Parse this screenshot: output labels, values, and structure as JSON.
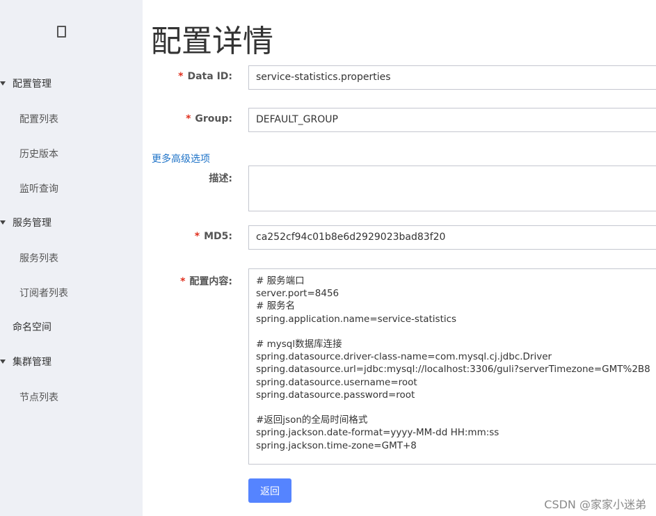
{
  "sidebar": {
    "groups": [
      {
        "label": "配置管理",
        "items": [
          "配置列表",
          "历史版本",
          "监听查询"
        ]
      },
      {
        "label": "服务管理",
        "items": [
          "服务列表",
          "订阅者列表"
        ]
      },
      {
        "label": "命名空间",
        "items": []
      },
      {
        "label": "集群管理",
        "items": [
          "节点列表"
        ]
      }
    ]
  },
  "page": {
    "title": "配置详情"
  },
  "form": {
    "required_mark": "*",
    "data_id": {
      "label": "Data ID:",
      "value": "service-statistics.properties"
    },
    "group": {
      "label": "Group:",
      "value": "DEFAULT_GROUP"
    },
    "advanced_link": "更多高级选项",
    "description": {
      "label": "描述:",
      "value": ""
    },
    "md5": {
      "label": "MD5:",
      "value": "ca252cf94c01b8e6d2929023bad83f20"
    },
    "content": {
      "label": "配置内容:",
      "value": "# 服务端口\nserver.port=8456\n# 服务名\nspring.application.name=service-statistics\n\n# mysql数据库连接\nspring.datasource.driver-class-name=com.mysql.cj.jdbc.Driver\nspring.datasource.url=jdbc:mysql://localhost:3306/guli?serverTimezone=GMT%2B8\nspring.datasource.username=root\nspring.datasource.password=root\n\n#返回json的全局时间格式\nspring.jackson.date-format=yyyy-MM-dd HH:mm:ss\nspring.jackson.time-zone=GMT+8"
    },
    "back_label": "返回"
  },
  "watermark": "CSDN @家家小迷弟",
  "colors": {
    "sidebar_bg": "#eef0f5",
    "primary_button": "#5584ff",
    "link": "#2074c8",
    "required": "#e0301e"
  }
}
